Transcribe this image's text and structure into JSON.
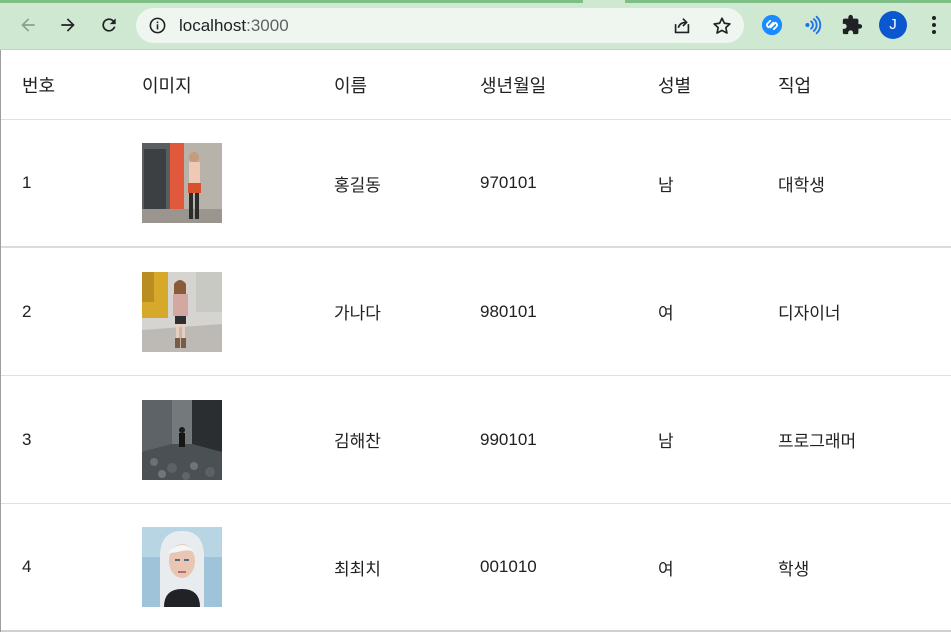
{
  "browser": {
    "url_host": "localhost",
    "url_port": ":3000",
    "profile_initial": "J",
    "icons": {
      "back": "arrow-left-icon",
      "forward": "arrow-right-icon",
      "reload": "reload-icon",
      "site_info": "info-icon",
      "share": "share-icon",
      "bookmark": "star-icon",
      "extension_1": "shazam-icon",
      "extension_2": "read-aloud-icon",
      "extensions": "puzzle-icon",
      "menu": "more-vert-icon"
    }
  },
  "table": {
    "headers": [
      "번호",
      "이미지",
      "이름",
      "생년월일",
      "성별",
      "직업"
    ],
    "rows": [
      {
        "id": "1",
        "name": "홍길동",
        "birthday": "970101",
        "gender": "남",
        "job": "대학생",
        "image": "person-photo-1"
      },
      {
        "id": "2",
        "name": "가나다",
        "birthday": "980101",
        "gender": "여",
        "job": "디자이너",
        "image": "person-photo-2"
      },
      {
        "id": "3",
        "name": "김해찬",
        "birthday": "990101",
        "gender": "남",
        "job": "프로그래머",
        "image": "person-photo-3"
      },
      {
        "id": "4",
        "name": "최최치",
        "birthday": "001010",
        "gender": "여",
        "job": "학생",
        "image": "person-photo-4"
      }
    ]
  },
  "colors": {
    "chrome_bg": "#cfe8d2",
    "omnibox_bg": "#eef6ef",
    "avatar": "#0b57d0"
  }
}
